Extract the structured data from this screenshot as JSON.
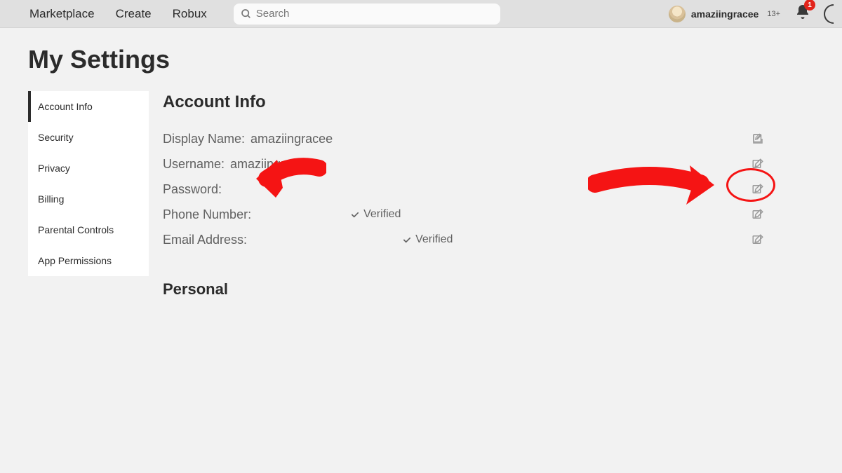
{
  "nav": {
    "marketplace": "Marketplace",
    "create": "Create",
    "robux": "Robux"
  },
  "search": {
    "placeholder": "Search"
  },
  "user": {
    "name": "amaziingracee",
    "age": "13+",
    "notif_count": "1"
  },
  "page": {
    "title": "My Settings"
  },
  "sidebar": {
    "items": [
      {
        "label": "Account Info",
        "active": true
      },
      {
        "label": "Security"
      },
      {
        "label": "Privacy"
      },
      {
        "label": "Billing"
      },
      {
        "label": "Parental Controls"
      },
      {
        "label": "App Permissions"
      }
    ]
  },
  "section": {
    "h1": "Account Info",
    "h2": "Personal"
  },
  "fields": {
    "display_name": {
      "label": "Display Name:",
      "value": "amaziingracee"
    },
    "username": {
      "label": "Username:",
      "value": "amaziingracee"
    },
    "password": {
      "label": "Password:"
    },
    "phone": {
      "label": "Phone Number:",
      "verified": "Verified"
    },
    "email": {
      "label": "Email Address:",
      "verified": "Verified"
    }
  }
}
